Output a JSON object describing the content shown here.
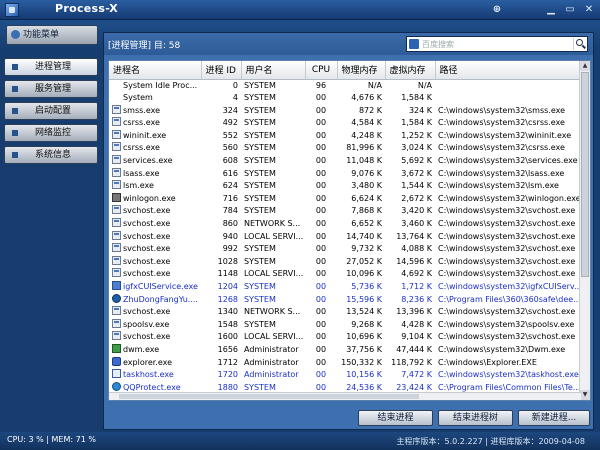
{
  "window": {
    "title": "Process-X",
    "controls": [
      "pin",
      "minimize",
      "restore",
      "close"
    ]
  },
  "menu_button": {
    "label": "功能菜单",
    "icon": "menu-icon"
  },
  "sidebar": {
    "items": [
      {
        "label": "进程管理",
        "active": true
      },
      {
        "label": "服务管理",
        "active": false
      },
      {
        "label": "启动配置",
        "active": false
      },
      {
        "label": "网络监控",
        "active": false
      },
      {
        "label": "系统信息",
        "active": false
      }
    ]
  },
  "main": {
    "header_label": "[进程管理] 目: 58",
    "search": {
      "placeholder": "百度搜索",
      "engine_icon": "baidu-icon",
      "button_icon": "search-icon"
    }
  },
  "table": {
    "columns": [
      "进程名",
      "进程 ID",
      "用户名",
      "CPU",
      "物理内存",
      "虚拟内存",
      "路径"
    ],
    "rows": [
      {
        "icon": "none",
        "name": "System Idle Proc...",
        "pid": "0",
        "user": "SYSTEM",
        "cpu": "96",
        "mem": "N/A",
        "vmem": "N/A",
        "path": "",
        "highlight": false
      },
      {
        "icon": "none",
        "name": "System",
        "pid": "4",
        "user": "SYSTEM",
        "cpu": "00",
        "mem": "4,676 K",
        "vmem": "1,584 K",
        "path": "",
        "highlight": false
      },
      {
        "icon": "exe",
        "name": "smss.exe",
        "pid": "324",
        "user": "SYSTEM",
        "cpu": "00",
        "mem": "872 K",
        "vmem": "324 K",
        "path": "C:\\windows\\system32\\smss.exe",
        "highlight": false
      },
      {
        "icon": "exe",
        "name": "csrss.exe",
        "pid": "492",
        "user": "SYSTEM",
        "cpu": "00",
        "mem": "4,584 K",
        "vmem": "1,584 K",
        "path": "C:\\windows\\system32\\csrss.exe",
        "highlight": false
      },
      {
        "icon": "exe",
        "name": "wininit.exe",
        "pid": "552",
        "user": "SYSTEM",
        "cpu": "00",
        "mem": "4,248 K",
        "vmem": "1,252 K",
        "path": "C:\\windows\\system32\\wininit.exe",
        "highlight": false
      },
      {
        "icon": "exe",
        "name": "csrss.exe",
        "pid": "560",
        "user": "SYSTEM",
        "cpu": "00",
        "mem": "81,996 K",
        "vmem": "3,024 K",
        "path": "C:\\windows\\system32\\csrss.exe",
        "highlight": false
      },
      {
        "icon": "exe",
        "name": "services.exe",
        "pid": "608",
        "user": "SYSTEM",
        "cpu": "00",
        "mem": "11,048 K",
        "vmem": "5,692 K",
        "path": "C:\\windows\\system32\\services.exe",
        "highlight": false
      },
      {
        "icon": "exe",
        "name": "lsass.exe",
        "pid": "616",
        "user": "SYSTEM",
        "cpu": "00",
        "mem": "9,076 K",
        "vmem": "3,672 K",
        "path": "C:\\windows\\system32\\lsass.exe",
        "highlight": false
      },
      {
        "icon": "exe",
        "name": "lsm.exe",
        "pid": "624",
        "user": "SYSTEM",
        "cpu": "00",
        "mem": "3,480 K",
        "vmem": "1,544 K",
        "path": "C:\\windows\\system32\\lsm.exe",
        "highlight": false
      },
      {
        "icon": "winlogon",
        "name": "winlogon.exe",
        "pid": "716",
        "user": "SYSTEM",
        "cpu": "00",
        "mem": "6,624 K",
        "vmem": "2,672 K",
        "path": "C:\\windows\\system32\\winlogon.exe",
        "highlight": false
      },
      {
        "icon": "exe",
        "name": "svchost.exe",
        "pid": "784",
        "user": "SYSTEM",
        "cpu": "00",
        "mem": "7,868 K",
        "vmem": "3,420 K",
        "path": "C:\\windows\\system32\\svchost.exe",
        "highlight": false
      },
      {
        "icon": "exe",
        "name": "svchost.exe",
        "pid": "860",
        "user": "NETWORK S...",
        "cpu": "00",
        "mem": "6,652 K",
        "vmem": "3,460 K",
        "path": "C:\\windows\\system32\\svchost.exe",
        "highlight": false
      },
      {
        "icon": "exe",
        "name": "svchost.exe",
        "pid": "940",
        "user": "LOCAL SERVI...",
        "cpu": "00",
        "mem": "14,740 K",
        "vmem": "13,764 K",
        "path": "C:\\windows\\system32\\svchost.exe",
        "highlight": false
      },
      {
        "icon": "exe",
        "name": "svchost.exe",
        "pid": "992",
        "user": "SYSTEM",
        "cpu": "00",
        "mem": "9,732 K",
        "vmem": "4,088 K",
        "path": "C:\\windows\\system32\\svchost.exe",
        "highlight": false
      },
      {
        "icon": "exe",
        "name": "svchost.exe",
        "pid": "1028",
        "user": "SYSTEM",
        "cpu": "00",
        "mem": "27,052 K",
        "vmem": "14,596 K",
        "path": "C:\\windows\\system32\\svchost.exe",
        "highlight": false
      },
      {
        "icon": "exe",
        "name": "svchost.exe",
        "pid": "1148",
        "user": "LOCAL SERVI...",
        "cpu": "00",
        "mem": "10,096 K",
        "vmem": "4,692 K",
        "path": "C:\\windows\\system32\\svchost.exe",
        "highlight": false
      },
      {
        "icon": "igfx",
        "name": "igfxCUIService.exe",
        "pid": "1204",
        "user": "SYSTEM",
        "cpu": "00",
        "mem": "5,736 K",
        "vmem": "1,712 K",
        "path": "C:\\windows\\system32\\igfxCUIServ...",
        "highlight": true
      },
      {
        "icon": "zhu",
        "name": "ZhuDongFangYu....",
        "pid": "1268",
        "user": "SYSTEM",
        "cpu": "00",
        "mem": "15,596 K",
        "vmem": "8,236 K",
        "path": "C:\\Program Files\\360\\360safe\\dee...",
        "highlight": true
      },
      {
        "icon": "exe",
        "name": "svchost.exe",
        "pid": "1340",
        "user": "NETWORK S...",
        "cpu": "00",
        "mem": "13,524 K",
        "vmem": "13,396 K",
        "path": "C:\\windows\\system32\\svchost.exe",
        "highlight": false
      },
      {
        "icon": "exe",
        "name": "spoolsv.exe",
        "pid": "1548",
        "user": "SYSTEM",
        "cpu": "00",
        "mem": "9,268 K",
        "vmem": "4,428 K",
        "path": "C:\\windows\\system32\\spoolsv.exe",
        "highlight": false
      },
      {
        "icon": "exe",
        "name": "svchost.exe",
        "pid": "1600",
        "user": "LOCAL SERVI...",
        "cpu": "00",
        "mem": "10,696 K",
        "vmem": "9,104 K",
        "path": "C:\\windows\\system32\\svchost.exe",
        "highlight": false
      },
      {
        "icon": "dwm",
        "name": "dwm.exe",
        "pid": "1656",
        "user": "Administrator",
        "cpu": "00",
        "mem": "37,756 K",
        "vmem": "47,444 K",
        "path": "C:\\windows\\system32\\Dwm.exe",
        "highlight": false
      },
      {
        "icon": "ie",
        "name": "explorer.exe",
        "pid": "1712",
        "user": "Administrator",
        "cpu": "00",
        "mem": "150,332 K",
        "vmem": "118,792 K",
        "path": "C:\\windows\\Explorer.EXE",
        "highlight": false
      },
      {
        "icon": "taskhost",
        "name": "taskhost.exe",
        "pid": "1720",
        "user": "Administrator",
        "cpu": "00",
        "mem": "10,156 K",
        "vmem": "7,472 K",
        "path": "C:\\windows\\system32\\taskhost.exe",
        "highlight": true
      },
      {
        "icon": "qq",
        "name": "QQProtect.exe",
        "pid": "1880",
        "user": "SYSTEM",
        "cpu": "00",
        "mem": "24,536 K",
        "vmem": "23,424 K",
        "path": "C:\\Program Files\\Common Files\\Te...",
        "highlight": true
      }
    ]
  },
  "actions": {
    "end_process": "结束进程",
    "end_tree": "结束进程树",
    "new_process": "新建进程..."
  },
  "status": {
    "usage": "CPU: 3 % | MEM: 71 %",
    "version": "主程序版本：5.0.2.227 | 进程库版本：2009-04-08"
  }
}
